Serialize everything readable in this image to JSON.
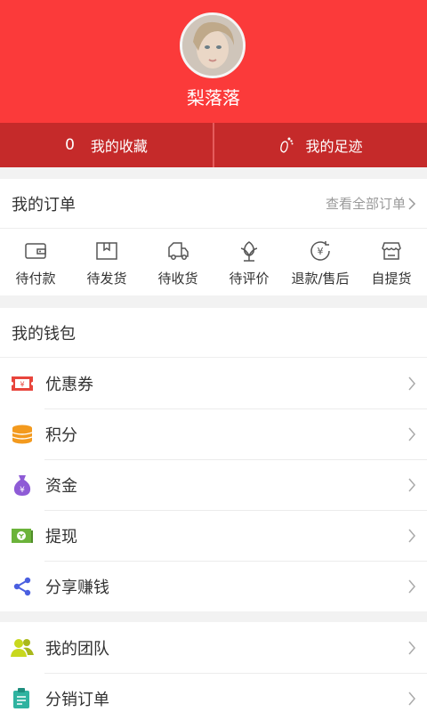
{
  "profile": {
    "username": "梨落落"
  },
  "stats": {
    "favorites_count": "0",
    "favorites_label": "我的收藏",
    "footprint_label": "我的足迹"
  },
  "orders": {
    "title": "我的订单",
    "view_all": "查看全部订单",
    "items": [
      {
        "label": "待付款",
        "icon": "wallet-icon"
      },
      {
        "label": "待发货",
        "icon": "package-icon"
      },
      {
        "label": "待收货",
        "icon": "truck-icon"
      },
      {
        "label": "待评价",
        "icon": "flower-icon"
      },
      {
        "label": "退款/售后",
        "icon": "refund-icon"
      },
      {
        "label": "自提货",
        "icon": "store-icon"
      }
    ]
  },
  "wallet": {
    "title": "我的钱包",
    "items": [
      {
        "label": "优惠券",
        "icon": "coupon-icon",
        "color": "#e8453c"
      },
      {
        "label": "积分",
        "icon": "coins-icon",
        "color": "#f39a1e"
      },
      {
        "label": "资金",
        "icon": "money-bag-icon",
        "color": "#8e5bd6"
      },
      {
        "label": "提现",
        "icon": "cash-icon",
        "color": "#6bb33a"
      },
      {
        "label": "分享赚钱",
        "icon": "share-icon",
        "color": "#4a5fe0"
      }
    ]
  },
  "team": {
    "items": [
      {
        "label": "我的团队",
        "icon": "team-icon",
        "color": "#c8d81e"
      },
      {
        "label": "分销订单",
        "icon": "clipboard-icon",
        "color": "#2fb3a0"
      }
    ]
  },
  "colors": {
    "brand_red": "#fb3a3a",
    "stat_bar": "#c52a2a"
  }
}
